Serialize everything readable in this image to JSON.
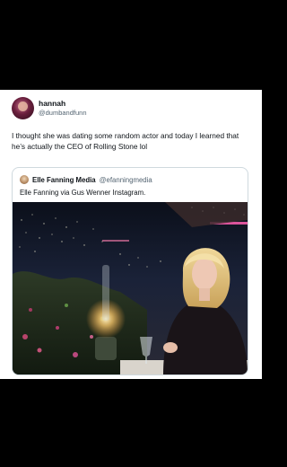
{
  "post": {
    "author": {
      "display_name": "hannah",
      "handle": "@dumbandfunn"
    },
    "text": "I thought she was dating some random actor and today I learned that he’s actually the CEO of Rolling Stone lol",
    "quoted": {
      "display_name": "Elle Fanning Media",
      "handle": "@efanningmedia",
      "text": "Elle Fanning via Gus Wenner Instagram."
    }
  },
  "colors": {
    "background": "#000000",
    "card": "#ffffff",
    "text_primary": "#0f1419",
    "text_secondary": "#536471",
    "border": "#cfd9de"
  }
}
